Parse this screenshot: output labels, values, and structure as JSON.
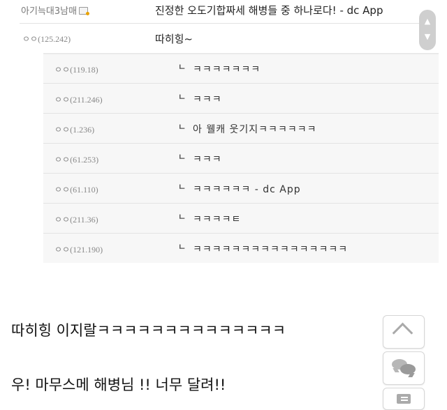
{
  "top_comment": {
    "nickname": "아기늑대3남매",
    "text": "진정한 오도기합짜세 해병들 중 하나로다! - dc App"
  },
  "parent_comment": {
    "ip": "ㅇㅇ(125.242)",
    "text": "따히힝~"
  },
  "replies": [
    {
      "ip": "ㅇㅇ(119.18)",
      "text": "ㅋㅋㅋㅋㅋㅋㅋ"
    },
    {
      "ip": "ㅇㅇ(211.246)",
      "text": "ㅋㅋㅋ"
    },
    {
      "ip": "ㅇㅇ(1.236)",
      "text": "아 웰캐 웃기지ㅋㅋㅋㅋㅋㅋ"
    },
    {
      "ip": "ㅇㅇ(61.253)",
      "text": "ㅋㅋㅋ"
    },
    {
      "ip": "ㅇㅇ(61.110)",
      "text": "ㅋㅋㅋㅋㅋㅋ - dc App"
    },
    {
      "ip": "ㅇㅇ(211.36)",
      "text": "ㅋㅋㅋㅋㅌ"
    },
    {
      "ip": "ㅇㅇ(121.190)",
      "text": "ㅋㅋㅋㅋㅋㅋㅋㅋㅋㅋㅋㅋㅋㅋㅋㅋ"
    }
  ],
  "reply_arrow": "ㄴ",
  "scroll_buttons": {
    "up": "▲",
    "down": "▼"
  },
  "body_text": {
    "line1": "따히힝 이지랄ㅋㅋㅋㅋㅋㅋㅋㅋㅋㅋㅋㅋㅋㅋ",
    "line2": "우! 마무스메 해병님 !! 너무 달려!!"
  },
  "floating_buttons": [
    "scroll-top-icon",
    "comment-icon",
    "list-icon"
  ],
  "colors": {
    "reply_bg": "#f7f7f7",
    "text": "#333333",
    "muted": "#888888"
  }
}
